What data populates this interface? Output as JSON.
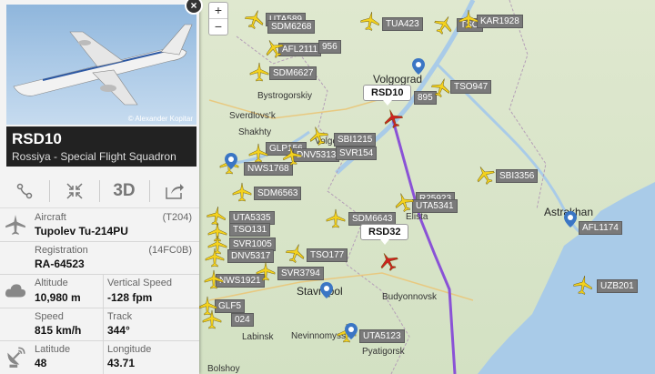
{
  "panel": {
    "photo_credit": "© Alexander Kopitar",
    "close_label": "×",
    "callsign": "RSD10",
    "operator": "Rossiya - Special Flight Squadron",
    "tools": {
      "route_icon": "route-icon",
      "expand_icon": "expand-icon",
      "threed_label": "3D",
      "share_icon": "share-icon"
    },
    "aircraft": {
      "label": "Aircraft",
      "code": "(T204)",
      "value": "Tupolev Tu-214PU"
    },
    "registration": {
      "label": "Registration",
      "code": "(14FC0B)",
      "value": "RA-64523"
    },
    "altitude": {
      "label": "Altitude",
      "value": "10,980 m"
    },
    "vertical_speed": {
      "label": "Vertical Speed",
      "value": "-128 fpm"
    },
    "speed": {
      "label": "Speed",
      "value": "815 km/h"
    },
    "track": {
      "label": "Track",
      "value": "344°"
    },
    "latitude": {
      "label": "Latitude",
      "value": "48"
    },
    "longitude": {
      "label": "Longitude",
      "value": "43.71"
    }
  },
  "map": {
    "zoom_in": "+",
    "zoom_out": "−",
    "callouts": [
      "RSD10",
      "RSD32"
    ],
    "cities": {
      "volgograd": "Volgograd",
      "bystrogorskiy": "Bystrogorskiy",
      "sverdlovsk": "Sverdlovs'k",
      "shakhty": "Shakhty",
      "volgodonsk": "Volgo",
      "elista": "Elista",
      "astrakhan": "Astrakhan",
      "stavropol": "Stavropol",
      "budyonnovsk": "Budyonnovsk",
      "nevinnomyssk": "Nevinnomyss",
      "labinsk": "Labinsk",
      "pyatigorsk": "Pyatigorsk",
      "bolshoy": "Bolshoy"
    },
    "flight_labels": {
      "uta589": "UTA589",
      "sdm": "SDM6268",
      "afl2111": "AFL2111",
      "f956": "956",
      "tua423": "TUA423",
      "tso": "TSO",
      "kar1928": "KAR1928",
      "sdm6627": "SDM6627",
      "n895": "895",
      "tso947": "TSO947",
      "sbi1215": "SBI1215",
      "glp156": "GLP156",
      "dnv5313": "DNV5313",
      "svr154": "SVR154",
      "nws1768": "NWS1768",
      "sbi3356": "SBI3356",
      "sdm6563": "SDM6563",
      "r25923": "R25923",
      "uta5341": "UTA5341",
      "uta5335": "UTA5335",
      "sdm6643": "SDM6643",
      "tso131": "TSO131",
      "afl1174": "AFL1174",
      "svr1005": "SVR1005",
      "dnv5317": "DNV5317",
      "tso177": "TSO177",
      "svr3794": "SVR3794",
      "nws1921": "NWS1921",
      "uzb201": "UZB201",
      "glf5": "GLF5",
      "n024": "024",
      "uta5123": "UTA5123"
    }
  },
  "colors": {
    "track": "#8a52d6",
    "plane": "#f4d21e",
    "selected_plane": "#d02020",
    "water": "#a9cbe8"
  }
}
